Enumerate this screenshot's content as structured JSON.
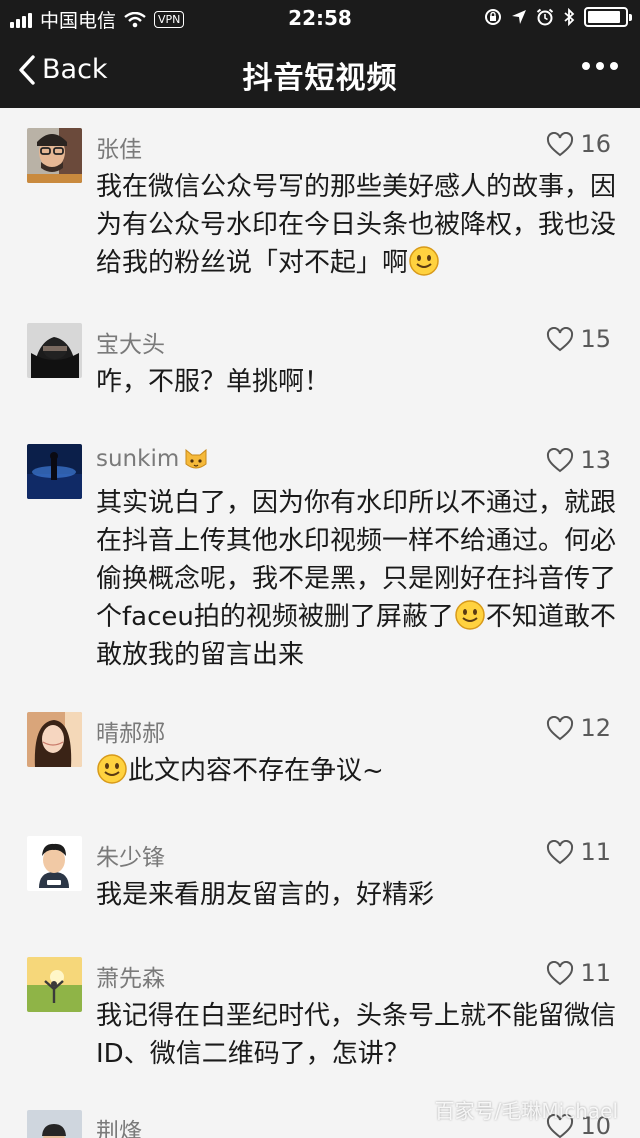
{
  "status_bar": {
    "carrier": "中国电信",
    "vpn": "VPN",
    "time": "22:58"
  },
  "nav": {
    "back_label": "Back",
    "title": "抖音短视频"
  },
  "comments": [
    {
      "name": "张佳",
      "likes": "16",
      "text_a": "我在微信公众号写的那些美好感人的故事，因为有公众号水印在今日头条也被降权，我也没给我的粉丝说「对不起」啊",
      "text_b": ""
    },
    {
      "name": "宝大头",
      "likes": "15",
      "text_a": "咋，不服？单挑啊！",
      "text_b": ""
    },
    {
      "name": "sunkim",
      "likes": "13",
      "text_a": "其实说白了，因为你有水印所以不通过，就跟在抖音上传其他水印视频一样不给通过。何必偷换概念呢，我不是黑，只是刚好在抖音传了个faceu拍的视频被删了屏蔽了",
      "text_b": "不知道敢不敢放我的留言出来"
    },
    {
      "name": "晴郝郝",
      "likes": "12",
      "text_a": "",
      "text_b": "此文内容不存在争议~"
    },
    {
      "name": "朱少锋",
      "likes": "11",
      "text_a": "我是来看朋友留言的，好精彩",
      "text_b": ""
    },
    {
      "name": "萧先森",
      "likes": "11",
      "text_a": "我记得在白垩纪时代，头条号上就不能留微信ID、微信二维码了，怎讲？",
      "text_b": ""
    },
    {
      "name": "荆烽",
      "likes": "10",
      "text_a": "",
      "text_b": ""
    }
  ],
  "watermark": "百家号/毛琳Michael",
  "colors": {
    "header_bg": "#1b1b1b",
    "page_bg": "#f4f4f4",
    "name_text": "#7a7a7a",
    "body_text": "#1a1a1a"
  },
  "icons": [
    "signal-icon",
    "wifi-icon",
    "lock-rotation-icon",
    "location-arrow-icon",
    "alarm-icon",
    "bluetooth-icon",
    "battery-icon",
    "back-chevron-icon",
    "more-dots-icon",
    "heart-icon",
    "smile-emoji-icon",
    "cat-emoji-icon"
  ]
}
